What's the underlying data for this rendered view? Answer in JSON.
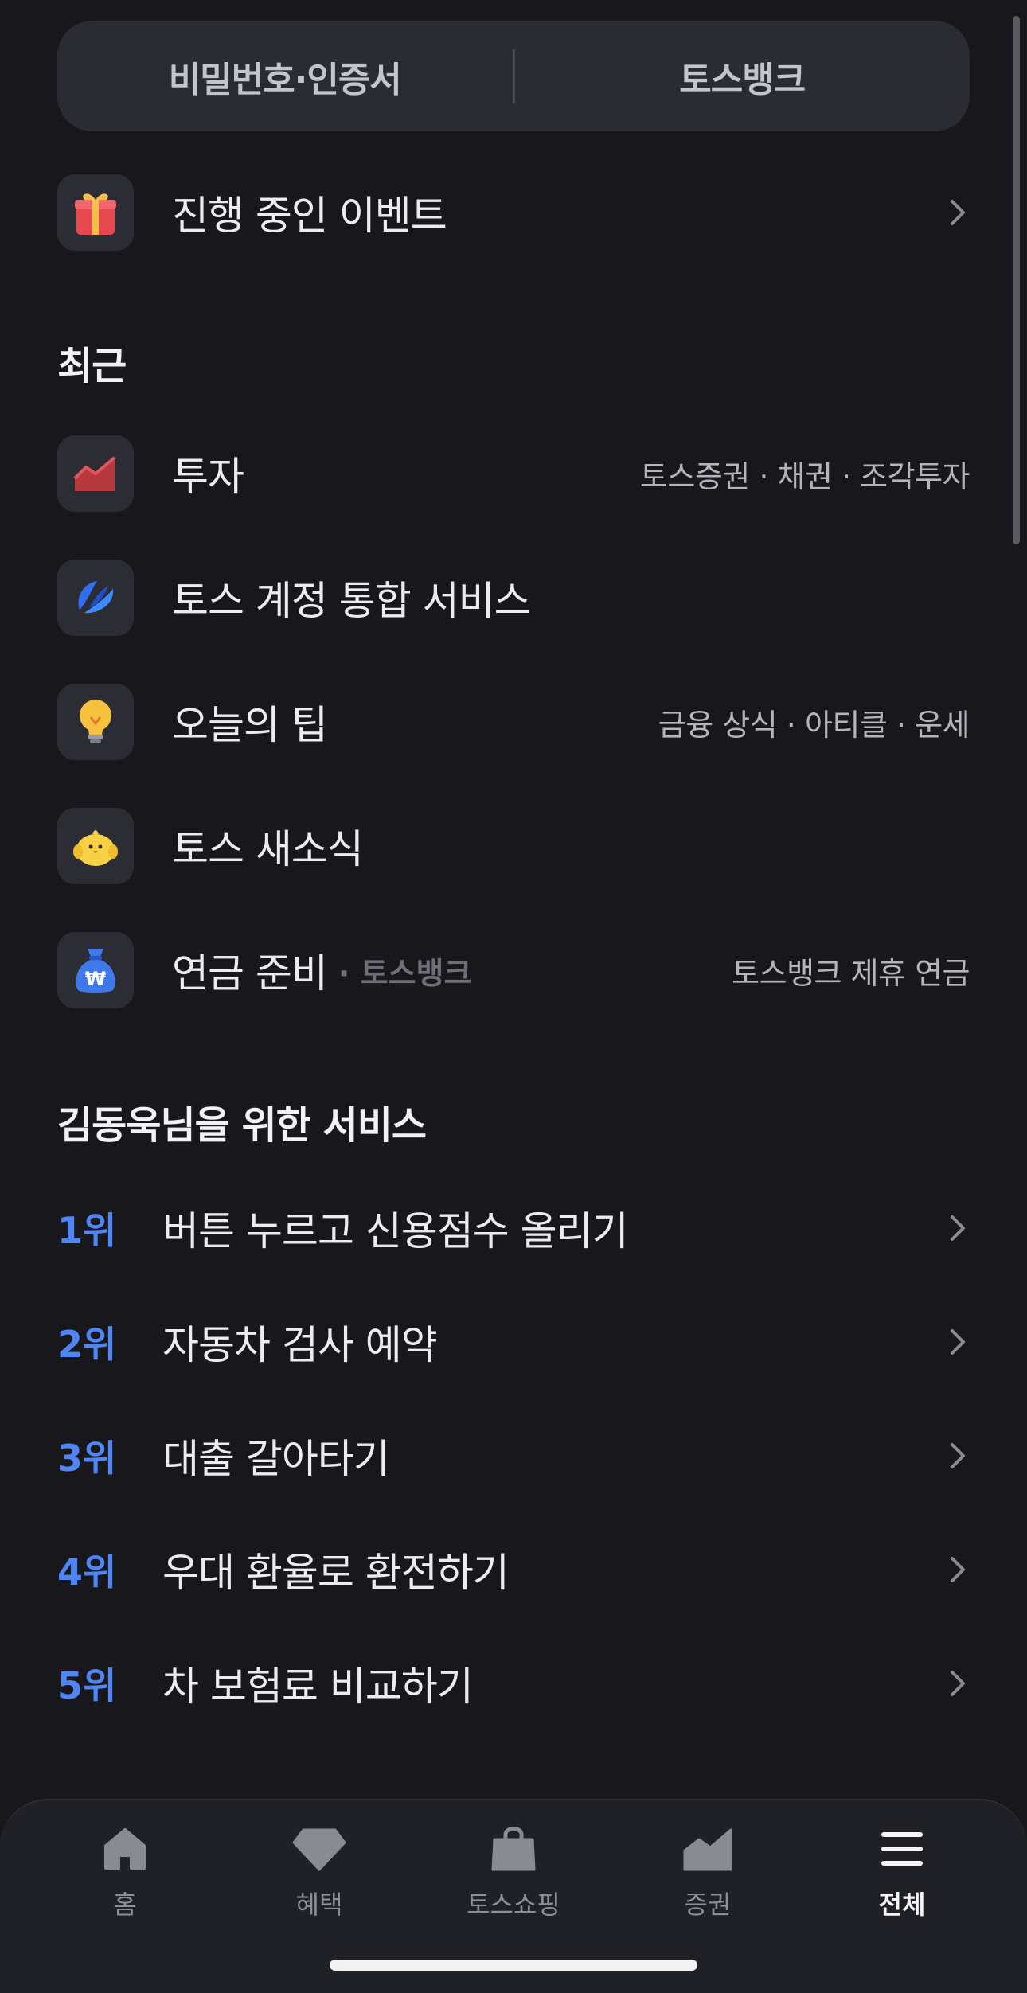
{
  "top_card": {
    "left_label": "비밀번호·인증서",
    "right_label": "토스뱅크"
  },
  "event_row": {
    "label": "진행 중인 이벤트",
    "icon": "gift-icon"
  },
  "recent": {
    "title": "최근",
    "items": [
      {
        "label": "투자",
        "sub": "",
        "right": "토스증권 · 채권 · 조각투자",
        "icon": "chart-icon"
      },
      {
        "label": "토스 계정 통합 서비스",
        "sub": "",
        "right": "",
        "icon": "toss-logo-icon"
      },
      {
        "label": "오늘의 팁",
        "sub": "",
        "right": "금융 상식 · 아티클 · 운세",
        "icon": "lightbulb-icon"
      },
      {
        "label": "토스 새소식",
        "sub": "",
        "right": "",
        "icon": "chick-icon"
      },
      {
        "label": "연금 준비",
        "sub": "· 토스뱅크",
        "right": "토스뱅크 제휴 연금",
        "icon": "money-bag-icon"
      }
    ]
  },
  "services": {
    "title": "김동욱님을 위한 서비스",
    "items": [
      {
        "rank": "1위",
        "label": "버튼 누르고 신용점수 올리기"
      },
      {
        "rank": "2위",
        "label": "자동차 검사 예약"
      },
      {
        "rank": "3위",
        "label": "대출 갈아타기"
      },
      {
        "rank": "4위",
        "label": "우대 환율로 환전하기"
      },
      {
        "rank": "5위",
        "label": "차 보험료 비교하기"
      }
    ]
  },
  "tabbar": {
    "tabs": [
      {
        "label": "홈",
        "icon": "home-icon"
      },
      {
        "label": "혜택",
        "icon": "diamond-icon"
      },
      {
        "label": "토스쇼핑",
        "icon": "shopping-bag-icon"
      },
      {
        "label": "증권",
        "icon": "stock-chart-icon"
      },
      {
        "label": "전체",
        "icon": "menu-icon"
      }
    ],
    "active": "전체"
  },
  "colors": {
    "background": "#17171c",
    "card": "#2b2b33",
    "rank_accent": "#4f86f3",
    "tabbar": "#202027"
  }
}
